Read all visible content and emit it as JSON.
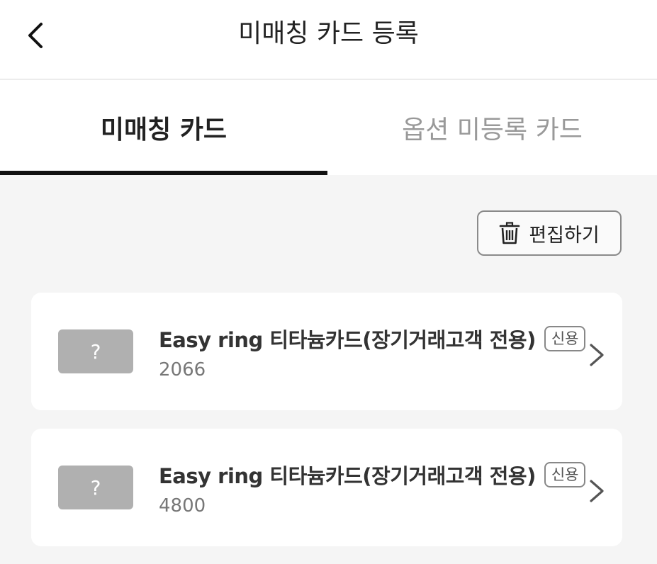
{
  "header": {
    "title": "미매칭 카드 등록"
  },
  "tabs": [
    {
      "label": "미매칭 카드",
      "active": true
    },
    {
      "label": "옵션 미등록 카드",
      "active": false
    }
  ],
  "toolbar": {
    "edit_label": "편집하기",
    "edit_icon": "trash-icon"
  },
  "cards": [
    {
      "thumb": "?",
      "name": "Easy ring 티타늄카드(장기거래고객 전용)",
      "badge": "신용",
      "number": "2066"
    },
    {
      "thumb": "?",
      "name": "Easy ring 티타늄카드(장기거래고객 전용)",
      "badge": "신용",
      "number": "4800"
    }
  ],
  "colors": {
    "background": "#f5f5f5",
    "surface": "#ffffff",
    "active_tab_underline": "#111111",
    "inactive_tab_text": "#999999",
    "thumb_placeholder": "#b0b0b0"
  }
}
